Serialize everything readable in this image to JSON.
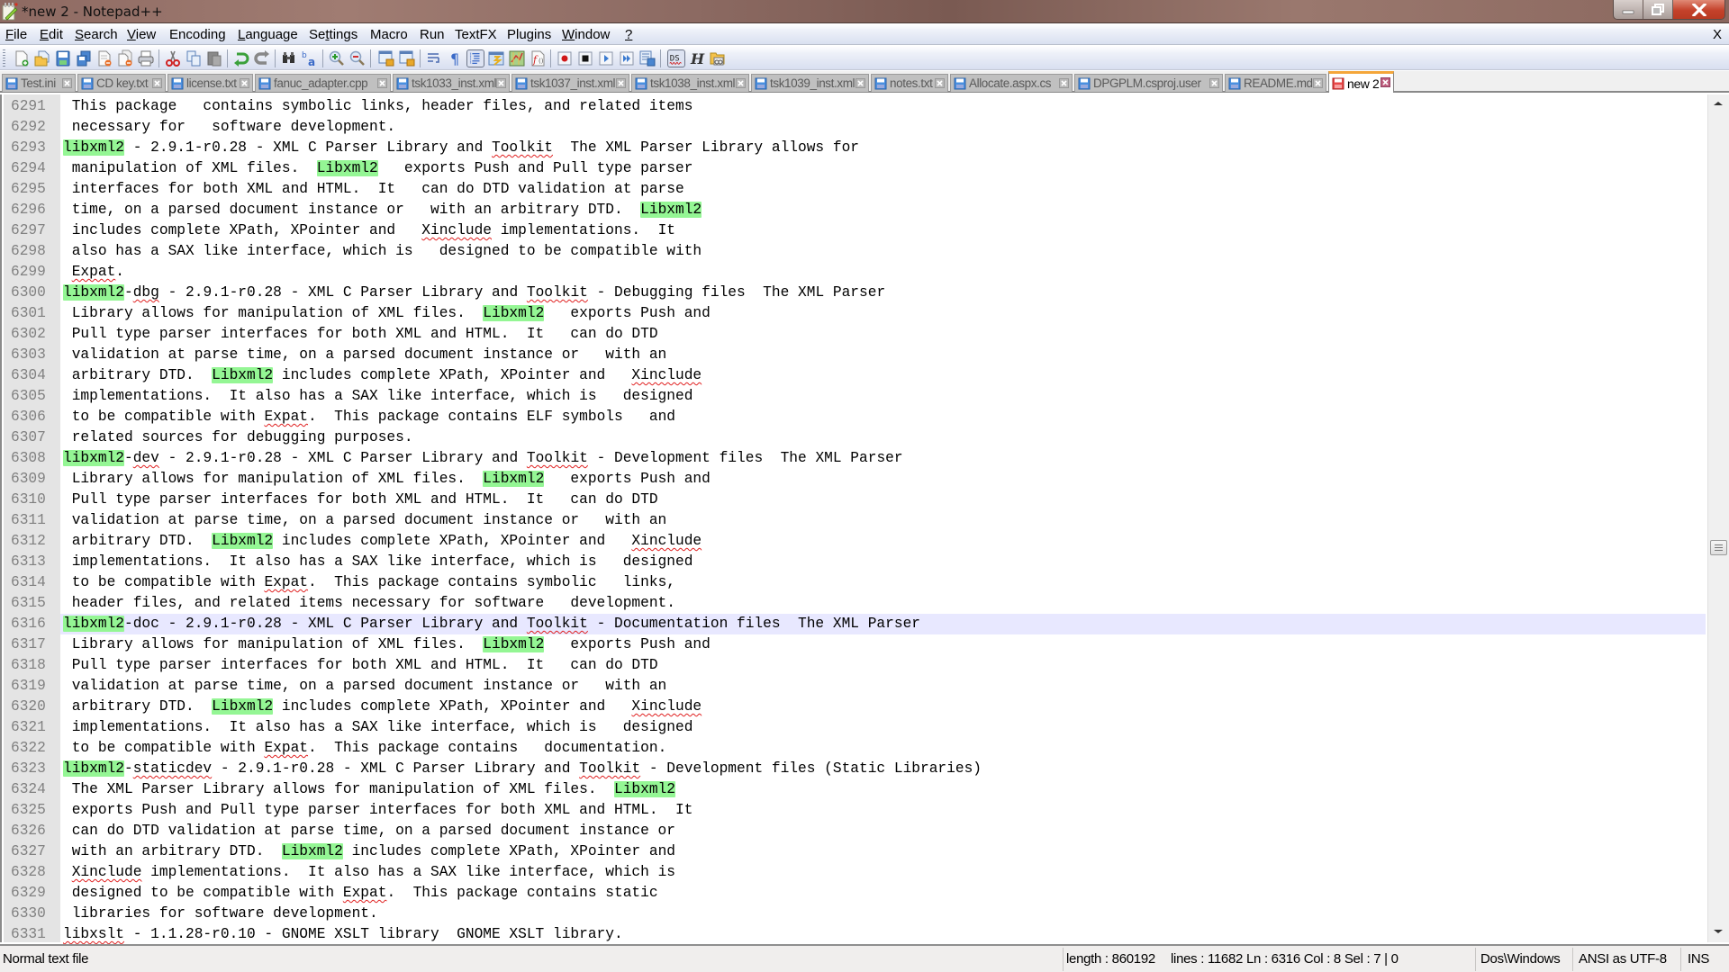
{
  "window": {
    "title": "*new  2 - Notepad++",
    "controls": [
      "minimize",
      "restore",
      "close"
    ]
  },
  "menubar": {
    "items": [
      {
        "label": "File",
        "accel": "F"
      },
      {
        "label": "Edit",
        "accel": "E"
      },
      {
        "label": "Search",
        "accel": "S"
      },
      {
        "label": "View",
        "accel": "V"
      },
      {
        "label": "Encoding",
        "accel": ""
      },
      {
        "label": "Language",
        "accel": "L"
      },
      {
        "label": "Settings",
        "accel": "t"
      },
      {
        "label": "Macro",
        "accel": ""
      },
      {
        "label": "Run",
        "accel": ""
      },
      {
        "label": "TextFX",
        "accel": ""
      },
      {
        "label": "Plugins",
        "accel": ""
      },
      {
        "label": "Window",
        "accel": "W"
      },
      {
        "label": "?",
        "accel": "?"
      }
    ],
    "close_label": "X"
  },
  "toolbar": {
    "buttons": [
      "new-file-icon",
      "open-file-icon",
      "save-icon",
      "save-all-icon",
      "close-icon",
      "close-all-icon",
      "print-icon",
      "cut-icon",
      "copy-icon",
      "paste-icon",
      "undo-icon",
      "redo-icon",
      "find-icon",
      "replace-icon",
      "zoom-in-icon",
      "zoom-out-icon",
      "sync-vertical-icon",
      "sync-horizontal-icon",
      "word-wrap-icon",
      "show-all-chars-icon",
      "indent-guide-icon",
      "user-defined-language-icon",
      "document-map-icon",
      "function-list-icon",
      "record-macro-icon",
      "stop-macro-icon",
      "play-macro-icon",
      "run-macro-multiple-icon",
      "save-macro-icon",
      "spell-check-icon",
      "hex-editor-icon",
      "compare-icon"
    ]
  },
  "tabs": [
    {
      "label": "Test.ini",
      "state": "saved",
      "active": false
    },
    {
      "label": "CD key.txt",
      "state": "saved",
      "active": false
    },
    {
      "label": "license.txt",
      "state": "saved",
      "active": false
    },
    {
      "label": "fanuc_adapter.cpp",
      "state": "saved",
      "active": false
    },
    {
      "label": "tsk1033_inst.xml",
      "state": "saved",
      "active": false
    },
    {
      "label": "tsk1037_inst.xml",
      "state": "saved",
      "active": false
    },
    {
      "label": "tsk1038_inst.xml",
      "state": "saved",
      "active": false
    },
    {
      "label": "tsk1039_inst.xml",
      "state": "saved",
      "active": false
    },
    {
      "label": "notes.txt",
      "state": "saved",
      "active": false
    },
    {
      "label": "Allocate.aspx.cs",
      "state": "saved",
      "active": false
    },
    {
      "label": "DPGPLM.csproj.user",
      "state": "saved",
      "active": false
    },
    {
      "label": "README.md",
      "state": "saved",
      "active": false
    },
    {
      "label": "new 2",
      "state": "modified",
      "active": true
    }
  ],
  "editor": {
    "current_line": 6316,
    "highlight_color": "#94f694",
    "current_line_color": "#e8e8ff",
    "lines": [
      {
        "n": "6291",
        "segs": [
          {
            "t": " This package   contains symbolic links, header files, and related items"
          }
        ]
      },
      {
        "n": "6292",
        "segs": [
          {
            "t": " necessary for   software development."
          }
        ]
      },
      {
        "n": "6293",
        "segs": [
          {
            "t": "libxml2",
            "hl": true
          },
          {
            "t": " - 2.9.1-r0.28 - XML C Parser Library and "
          },
          {
            "t": "Toolkit",
            "sq": true
          },
          {
            "t": "  The XML Parser Library allows for"
          }
        ]
      },
      {
        "n": "6294",
        "segs": [
          {
            "t": " manipulation of XML files.  "
          },
          {
            "t": "Libxml2",
            "hl": true
          },
          {
            "t": "   exports Push and Pull type parser"
          }
        ]
      },
      {
        "n": "6295",
        "segs": [
          {
            "t": " interfaces for both XML and HTML.  It   can do DTD validation at parse"
          }
        ]
      },
      {
        "n": "6296",
        "segs": [
          {
            "t": " time, on a parsed document instance or   with an arbitrary DTD.  "
          },
          {
            "t": "Libxml2",
            "hl": true
          }
        ]
      },
      {
        "n": "6297",
        "segs": [
          {
            "t": " includes complete XPath, XPointer and   "
          },
          {
            "t": "Xinclude",
            "sq": true
          },
          {
            "t": " implementations.  It"
          }
        ]
      },
      {
        "n": "6298",
        "segs": [
          {
            "t": " also has a SAX like interface, which is   designed to be compatible with"
          }
        ]
      },
      {
        "n": "6299",
        "segs": [
          {
            "t": " "
          },
          {
            "t": "Expat",
            "sq": true
          },
          {
            "t": "."
          }
        ]
      },
      {
        "n": "6300",
        "segs": [
          {
            "t": "libxml2",
            "hl": true
          },
          {
            "t": "-"
          },
          {
            "t": "dbg",
            "sq": true
          },
          {
            "t": " - 2.9.1-r0.28 - XML C Parser Library and "
          },
          {
            "t": "Toolkit",
            "sq": true
          },
          {
            "t": " - Debugging files  The XML Parser"
          }
        ]
      },
      {
        "n": "6301",
        "segs": [
          {
            "t": " Library allows for manipulation of XML files.  "
          },
          {
            "t": "Libxml2",
            "hl": true
          },
          {
            "t": "   exports Push and"
          }
        ]
      },
      {
        "n": "6302",
        "segs": [
          {
            "t": " Pull type parser interfaces for both XML and HTML.  It   can do DTD"
          }
        ]
      },
      {
        "n": "6303",
        "segs": [
          {
            "t": " validation at parse time, on a parsed document instance or   with an"
          }
        ]
      },
      {
        "n": "6304",
        "segs": [
          {
            "t": " arbitrary DTD.  "
          },
          {
            "t": "Libxml2",
            "hl": true
          },
          {
            "t": " includes complete XPath, XPointer and   "
          },
          {
            "t": "Xinclude",
            "sq": true
          }
        ]
      },
      {
        "n": "6305",
        "segs": [
          {
            "t": " implementations.  It also has a SAX like interface, which is   designed"
          }
        ]
      },
      {
        "n": "6306",
        "segs": [
          {
            "t": " to be compatible with "
          },
          {
            "t": "Expat",
            "sq": true
          },
          {
            "t": ".  This package contains ELF symbols   and"
          }
        ]
      },
      {
        "n": "6307",
        "segs": [
          {
            "t": " related sources for debugging purposes."
          }
        ]
      },
      {
        "n": "6308",
        "segs": [
          {
            "t": "libxml2",
            "hl": true
          },
          {
            "t": "-"
          },
          {
            "t": "dev",
            "sq": true
          },
          {
            "t": " - 2.9.1-r0.28 - XML C Parser Library and "
          },
          {
            "t": "Toolkit",
            "sq": true
          },
          {
            "t": " - Development files  The XML Parser"
          }
        ]
      },
      {
        "n": "6309",
        "segs": [
          {
            "t": " Library allows for manipulation of XML files.  "
          },
          {
            "t": "Libxml2",
            "hl": true
          },
          {
            "t": "   exports Push and"
          }
        ]
      },
      {
        "n": "6310",
        "segs": [
          {
            "t": " Pull type parser interfaces for both XML and HTML.  It   can do DTD"
          }
        ]
      },
      {
        "n": "6311",
        "segs": [
          {
            "t": " validation at parse time, on a parsed document instance or   with an"
          }
        ]
      },
      {
        "n": "6312",
        "segs": [
          {
            "t": " arbitrary DTD.  "
          },
          {
            "t": "Libxml2",
            "hl": true
          },
          {
            "t": " includes complete XPath, XPointer and   "
          },
          {
            "t": "Xinclude",
            "sq": true
          }
        ]
      },
      {
        "n": "6313",
        "segs": [
          {
            "t": " implementations.  It also has a SAX like interface, which is   designed"
          }
        ]
      },
      {
        "n": "6314",
        "segs": [
          {
            "t": " to be compatible with "
          },
          {
            "t": "Expat",
            "sq": true
          },
          {
            "t": ".  This package contains symbolic   links,"
          }
        ]
      },
      {
        "n": "6315",
        "segs": [
          {
            "t": " header files, and related items necessary for software   development."
          }
        ]
      },
      {
        "n": "6316",
        "segs": [
          {
            "t": "libxml2",
            "hl": true
          },
          {
            "t": "-doc - 2.9.1-r0.28 - XML C Parser Library and "
          },
          {
            "t": "Toolkit",
            "sq": true
          },
          {
            "t": " - Documentation files  The XML Parser"
          }
        ]
      },
      {
        "n": "6317",
        "segs": [
          {
            "t": " Library allows for manipulation of XML files.  "
          },
          {
            "t": "Libxml2",
            "hl": true
          },
          {
            "t": "   exports Push and"
          }
        ]
      },
      {
        "n": "6318",
        "segs": [
          {
            "t": " Pull type parser interfaces for both XML and HTML.  It   can do DTD"
          }
        ]
      },
      {
        "n": "6319",
        "segs": [
          {
            "t": " validation at parse time, on a parsed document instance or   with an"
          }
        ]
      },
      {
        "n": "6320",
        "segs": [
          {
            "t": " arbitrary DTD.  "
          },
          {
            "t": "Libxml2",
            "hl": true
          },
          {
            "t": " includes complete XPath, XPointer and   "
          },
          {
            "t": "Xinclude",
            "sq": true
          }
        ]
      },
      {
        "n": "6321",
        "segs": [
          {
            "t": " implementations.  It also has a SAX like interface, which is   designed"
          }
        ]
      },
      {
        "n": "6322",
        "segs": [
          {
            "t": " to be compatible with "
          },
          {
            "t": "Expat",
            "sq": true
          },
          {
            "t": ".  This package contains   documentation."
          }
        ]
      },
      {
        "n": "6323",
        "segs": [
          {
            "t": "libxml2",
            "hl": true
          },
          {
            "t": "-"
          },
          {
            "t": "staticdev",
            "sq": true
          },
          {
            "t": " - 2.9.1-r0.28 - XML C Parser Library and "
          },
          {
            "t": "Toolkit",
            "sq": true
          },
          {
            "t": " - Development files (Static Libraries)"
          }
        ]
      },
      {
        "n": "6324",
        "segs": [
          {
            "t": " The XML Parser Library allows for manipulation of XML files.  "
          },
          {
            "t": "Libxml2",
            "hl": true
          }
        ]
      },
      {
        "n": "6325",
        "segs": [
          {
            "t": " exports Push and Pull type parser interfaces for both XML and HTML.  It"
          }
        ]
      },
      {
        "n": "6326",
        "segs": [
          {
            "t": " can do DTD validation at parse time, on a parsed document instance or"
          }
        ]
      },
      {
        "n": "6327",
        "segs": [
          {
            "t": " with an arbitrary DTD.  "
          },
          {
            "t": "Libxml2",
            "hl": true
          },
          {
            "t": " includes complete XPath, XPointer and"
          }
        ]
      },
      {
        "n": "6328",
        "segs": [
          {
            "t": " "
          },
          {
            "t": "Xinclude",
            "sq": true
          },
          {
            "t": " implementations.  It also has a SAX like interface, which is"
          }
        ]
      },
      {
        "n": "6329",
        "segs": [
          {
            "t": " designed to be compatible with "
          },
          {
            "t": "Expat",
            "sq": true
          },
          {
            "t": ".  This package contains static"
          }
        ]
      },
      {
        "n": "6330",
        "segs": [
          {
            "t": " libraries for software development."
          }
        ]
      },
      {
        "n": "6331",
        "segs": [
          {
            "t": "libxslt",
            "sq": true
          },
          {
            "t": " - 1.1.28-r0.10 - GNOME XSLT library  GNOME XSLT library."
          }
        ]
      }
    ]
  },
  "statusbar": {
    "file_type": "Normal text file",
    "length": "length : 860192",
    "lines": "lines : 11682",
    "position": "Ln : 6316    Col : 8    Sel : 7 | 0",
    "eol": "Dos\\Windows",
    "encoding": "ANSI as UTF-8",
    "mode": "INS"
  }
}
